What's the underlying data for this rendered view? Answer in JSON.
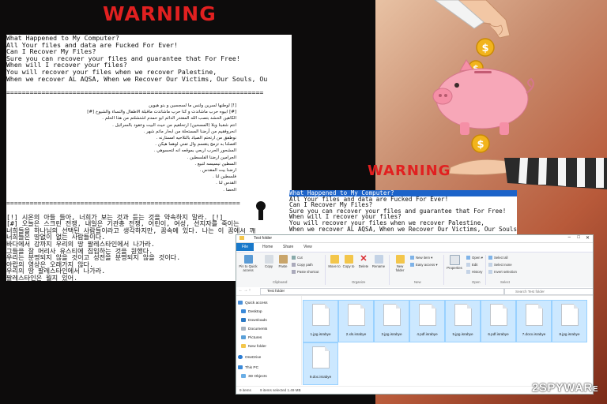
{
  "left_window": {
    "warning_title": "WARNING",
    "english_lines": [
      "What Happened to My Computer?",
      "All Your files and data are Fucked For Ever!",
      "Can I Recover My Files?",
      "Sure you can recover your files and guarantee that For Free!",
      "When will I recover your files?",
      "You will recover your files when we recover Palestine,",
      "When we recover AL AQSA, When we Recover Our Victims, Our Souls, Ou",
      "",
      "==================================================================",
      ""
    ],
    "arabic_heading": "[!]    لوطنها لسرين ولنس ما لسجسين و بنو هيوين",
    "arabic_line_1": "[#]  ابيوه حرب ماشاندت و كنا حرب ماشاندت ماقبلة الاطفال والنساء والشيوخ  [#]",
    "arabic_lines": [
      "الكاهين الحشد بتصب الله المقتدر الدائم ابو حمدم اشتشلتم من هذا الحلم  .",
      "انتم شقبنا وبلا (المسحين) ارتحلقيم من حيث البيت وعقود بالسرائيل  .",
      "انحروفقيم من أرضنا المستحلة من ابحار ماتم شهر  .",
      "نوطفق من ارتحتم الصياد بالنلاحيه امستارنه  .",
      "افصلنا به تزمج يتقسم وال تفني لوهما هيكن  .",
      "المشحور الحرب اربعي بموقعه انه لتحسوهي  .",
      "الجرامين ارضنا الفلسطين  .",
      "السطين نيسيسه لتبيع  .",
      "ارضنا بيت المقدس  .",
      "فلسطين لنا  .",
      "القدس لنا  .",
      "الحضا  ."
    ],
    "divider_2": "==================================================================",
    "korean_lines": [
      "[!] 시온의 아들 들아, 너희가 보는 것과 듣는 것을 약속하지 말라. [!]",
      "[#] 오늘은 스크린 전쟁, 내일은 기관총 전쟁, 어린이, 여성, 선지자를 죽이는 살",
      "너희들을 하나님의 선택된 사람들이라고 생각하지만, 꿈속에 있다. 나는 이 꿈에서 깨",
      "너희들은 땅없이 없는 사람들이다.",
      "바다에서 강까지 우리의 땅 팔레스타인에서 나가라.",
      "그들을 잘 머리사 유스티에 집입하는 것을 원했다.",
      "우리는 분명되지 않을 것이고 성전을 분명되지 않을 것이다.",
      "아랍의 영상은 오래가지 않다.",
      "우리의 땅 팔레스타인에서 나가라.",
      "팔레스타인은 뭘지 있어."
    ]
  },
  "right_window": {
    "warning_title": "WARNING",
    "note_lines": [
      "What Happened to My Computer?",
      "All Your files and data are Fucked For Ever!",
      "Can I Recover My Files?",
      "Sure you can recover your files and guarantee that For Free!",
      "When will I recover your files?",
      "You will recover your files when we recover Palestine,",
      "When we recover AL AQSA, When we Recover Our Victims, Our Souls, Ou"
    ]
  },
  "explorer": {
    "window_title": "Test folder",
    "tabs": [
      "File",
      "Home",
      "Share",
      "View"
    ],
    "ribbon": {
      "pin_label": "Pin to Quick access",
      "copy_label": "Copy",
      "paste_label": "Paste",
      "cut_label": "Cut",
      "copy_path_label": "Copy path",
      "paste_shortcut_label": "Paste shortcut",
      "move_to_label": "Move to",
      "copy_to_label": "Copy to",
      "delete_label": "Delete",
      "rename_label": "Rename",
      "new_folder_label": "New folder",
      "new_item_label": "New item",
      "easy_access_label": "Easy access",
      "properties_label": "Properties",
      "open_label": "Open",
      "edit_label": "Edit",
      "history_label": "History",
      "select_all_label": "Select all",
      "select_none_label": "Select none",
      "invert_selection_label": "Invert selection",
      "groups": [
        "Clipboard",
        "Organize",
        "New",
        "Open",
        "Select"
      ]
    },
    "address": "Test folder",
    "search_placeholder": "Search Test folder",
    "nav_items": [
      "Quick access",
      "Desktop",
      "Downloads",
      "Documents",
      "Pictures",
      "New folder",
      "OneDrive",
      "This PC",
      "3D Objects"
    ],
    "files": [
      "1.jpg.israbye",
      "2.xls.israbye",
      "3.jpg.israbye",
      "4.pdf.israbye",
      "5.jpg.israbye",
      "6.pdf.israbye",
      "7.docx.israbye",
      "8.jpg.israbye",
      "9.doc.israbye"
    ],
    "status_items": "9 items",
    "status_selected": "9 items selected  1.49 MB"
  },
  "watermark": {
    "num": "2",
    "name": "SPYWAR",
    "suffix": "E"
  },
  "colors": {
    "warning_red": "#e12020",
    "file_tab_blue": "#1979ca",
    "selection_blue": "#cce8ff",
    "note_highlight": "#1c63c9",
    "pig_pink": "#f7a7b8",
    "coin_gold": "#f2b41c"
  }
}
